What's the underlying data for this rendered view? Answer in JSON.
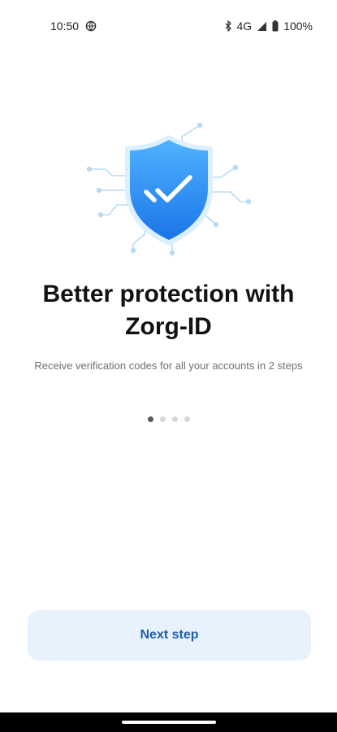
{
  "status_bar": {
    "time": "10:50",
    "network": "4G",
    "battery": "100%",
    "icons": [
      "vpn-globe-icon",
      "bluetooth-icon",
      "signal-icon",
      "battery-icon"
    ]
  },
  "onboarding": {
    "illustration": "shield-check-icon",
    "title": "Better protection with Zorg-ID",
    "subtitle": "Receive verification codes for all your accounts in 2 steps",
    "page_count": 4,
    "current_page": 1
  },
  "actions": {
    "next_label": "Next step"
  },
  "colors": {
    "accent": "#1f5fb0",
    "button_bg": "#e8f2fc",
    "shield_top": "#4fb3ff",
    "shield_bottom": "#1b74e8",
    "circuit": "#b8dbf5"
  }
}
